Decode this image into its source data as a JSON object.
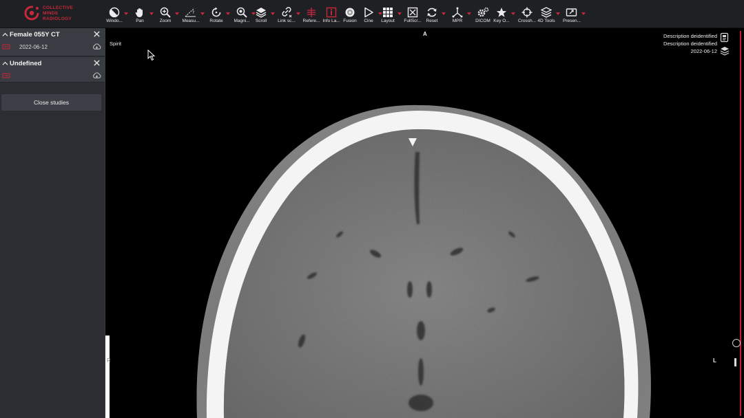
{
  "app": {
    "brand_line1": "Collective",
    "brand_line2": "Minds",
    "brand_line3": "Radiology",
    "accent_color": "#c8283a"
  },
  "toolbar": {
    "tools": [
      {
        "label": "Windo...",
        "icon": "contrast-icon",
        "caret": true
      },
      {
        "label": "Pan",
        "icon": "hand-icon",
        "caret": true
      },
      {
        "label": "Zoom",
        "icon": "zoom-icon",
        "caret": true
      },
      {
        "label": "Measu...",
        "icon": "measure-icon",
        "caret": true
      },
      {
        "label": "Rotate",
        "icon": "rotate-icon",
        "caret": true
      },
      {
        "label": "Magni...",
        "icon": "magnify-icon",
        "caret": true
      },
      {
        "label": "Scroll",
        "icon": "layers-icon",
        "caret": true
      },
      {
        "label": "Link sc...",
        "icon": "link-icon",
        "caret": true
      },
      {
        "label": "Refere...",
        "icon": "reference-lines-icon",
        "caret": false
      },
      {
        "label": "Info La...",
        "icon": "info-layer-icon",
        "caret": false
      },
      {
        "label": "Fusion",
        "icon": "fusion-icon",
        "caret": false
      },
      {
        "label": "Cine",
        "icon": "play-icon",
        "caret": true
      },
      {
        "label": "Layout",
        "icon": "grid-icon",
        "caret": true
      },
      {
        "label": "FullScr...",
        "icon": "fullscreen-icon",
        "caret": false
      },
      {
        "label": "Reset",
        "icon": "reset-icon",
        "caret": true
      },
      {
        "label": "MPR",
        "icon": "mpr-icon",
        "caret": true
      },
      {
        "label": "DICOM",
        "icon": "dicom-gear-icon",
        "caret": false
      },
      {
        "label": "Key O...",
        "icon": "star-icon",
        "caret": true
      },
      {
        "label": "Crossh...",
        "icon": "crosshair-icon",
        "caret": false
      },
      {
        "label": "4D Tools",
        "icon": "4d-tools-icon",
        "caret": true
      },
      {
        "label": "Presen...",
        "icon": "presentation-icon",
        "caret": true
      }
    ]
  },
  "sidebar": {
    "studies": [
      {
        "title": "Female 055Y CT",
        "date": "2022-06-12"
      },
      {
        "title": "Undefined",
        "date": ""
      }
    ],
    "close_studies_label": "Close studies"
  },
  "viewport": {
    "orientation_top": "A",
    "orientation_right": "L",
    "orientation_left": "R",
    "series_name": "Spirit",
    "description_line1": "Description deidentified",
    "description_line2": "Description deidentified",
    "study_date": "2022-06-12"
  }
}
